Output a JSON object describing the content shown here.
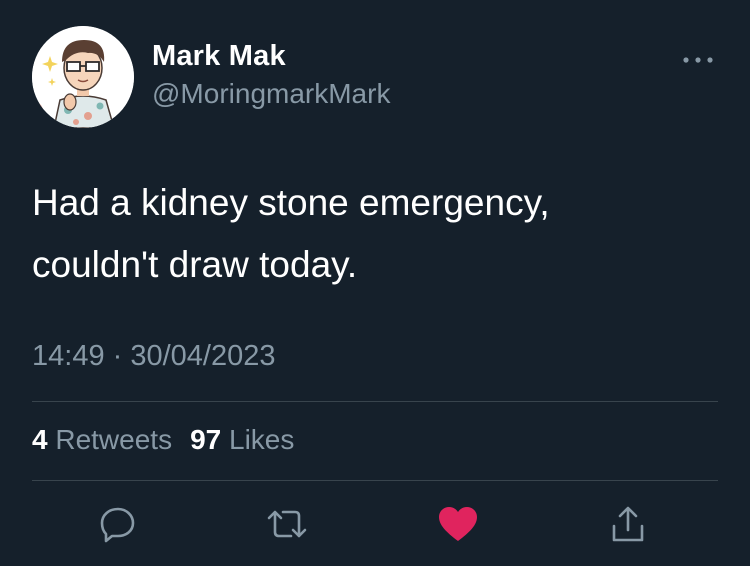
{
  "tweet": {
    "author": {
      "display_name": "Mark Mak",
      "handle": "@MoringmarkMark"
    },
    "text_lines": [
      "Had a kidney stone emergency,",
      "couldn't draw today."
    ],
    "timestamp": "14:49 · 30/04/2023",
    "stats": {
      "retweets_count": "4",
      "retweets_label": "Retweets",
      "likes_count": "97",
      "likes_label": "Likes"
    },
    "actions": {
      "reply_icon": "reply-icon",
      "retweet_icon": "retweet-icon",
      "like_icon": "heart-icon",
      "like_state": "liked",
      "share_icon": "share-icon"
    }
  },
  "colors": {
    "background": "#15202b",
    "primary_text": "#ffffff",
    "secondary_text": "#8899a6",
    "divider": "#38444d",
    "icon": "#8899a6",
    "liked": "#e0245e"
  }
}
